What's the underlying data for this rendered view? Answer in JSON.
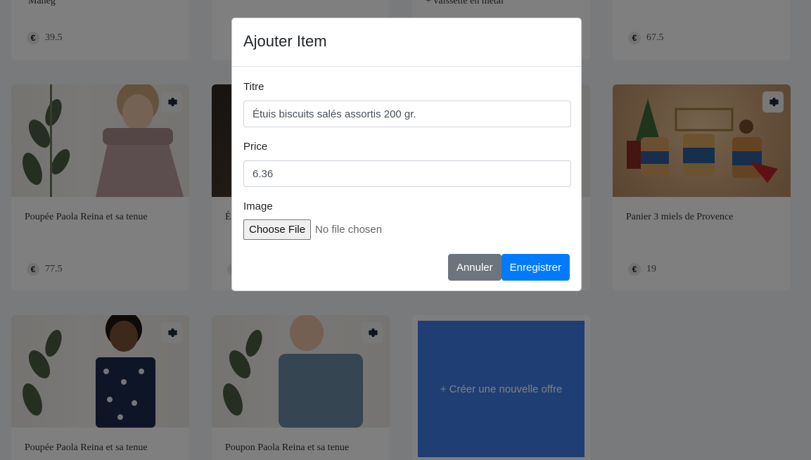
{
  "cards": [
    {
      "title": "Mahég",
      "price": "39.5"
    },
    {
      "title": "",
      "price": ""
    },
    {
      "title": "+ vaissette en métal",
      "price": ""
    },
    {
      "title": "",
      "price": "67.5"
    },
    {
      "title": "Poupée Paola Reina et sa tenue",
      "price": "77.5"
    },
    {
      "title": "É",
      "price": ""
    },
    {
      "title": "",
      "price": ""
    },
    {
      "title": "Panier 3 miels de Provence",
      "price": "19"
    },
    {
      "title": "Poupée Paola Reina et sa tenue",
      "price": ""
    },
    {
      "title": "Poupon Paola Reina et sa tenue",
      "price": ""
    }
  ],
  "currency_symbol": "€",
  "new_offer_label": "+ Créer une nouvelle offre",
  "modal": {
    "title": "Ajouter Item",
    "titre_label": "Titre",
    "titre_value": "Étuis biscuits salés assortis 200 gr.",
    "price_label": "Price",
    "price_value": "6.36",
    "image_label": "Image",
    "file_button": "Choose File",
    "file_status": "No file chosen",
    "cancel_label": "Annuler",
    "save_label": "Enregistrer"
  },
  "colors": {
    "primary": "#007bff",
    "secondary": "#6c757d",
    "offer_tile": "#3f7ee8"
  }
}
